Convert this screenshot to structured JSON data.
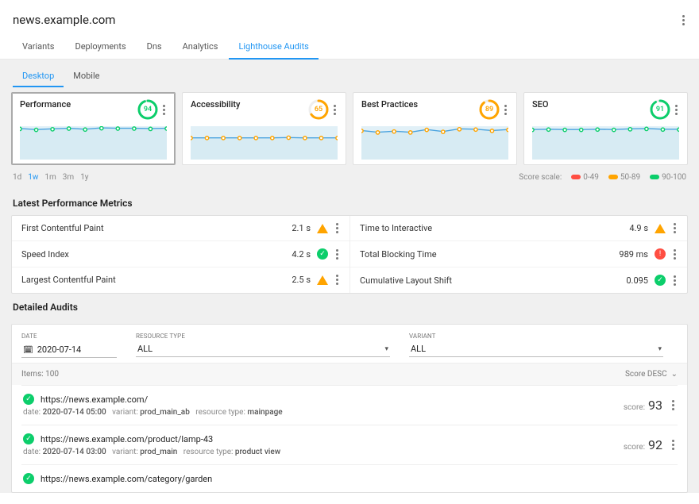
{
  "header": {
    "site_title": "news.example.com",
    "tabs": [
      "Variants",
      "Deployments",
      "Dns",
      "Analytics",
      "Lighthouse Audits"
    ],
    "active_tab_index": 4
  },
  "device_tabs": {
    "items": [
      "Desktop",
      "Mobile"
    ],
    "active_index": 0
  },
  "score_cards": [
    {
      "title": "Performance",
      "score": 94,
      "color": "#0cce6b",
      "selected": true
    },
    {
      "title": "Accessibility",
      "score": 65,
      "color": "#ffa400",
      "selected": false
    },
    {
      "title": "Best Practices",
      "score": 89,
      "color": "#ffa400",
      "selected": false
    },
    {
      "title": "SEO",
      "score": 91,
      "color": "#0cce6b",
      "selected": false
    }
  ],
  "chart_data": [
    {
      "type": "line",
      "title": "Performance",
      "series": [
        {
          "name": "score",
          "values": [
            93,
            90,
            92,
            94,
            91,
            95,
            94,
            94,
            93,
            94
          ]
        }
      ],
      "ylim": [
        0,
        100
      ],
      "point_color": "#0cce6b",
      "line_color": "#4aa3df"
    },
    {
      "type": "line",
      "title": "Accessibility",
      "series": [
        {
          "name": "score",
          "values": [
            65,
            65,
            65,
            65,
            65,
            65,
            66,
            65,
            65,
            65
          ]
        }
      ],
      "ylim": [
        0,
        100
      ],
      "point_color": "#ffa400",
      "line_color": "#4aa3df"
    },
    {
      "type": "line",
      "title": "Best Practices",
      "series": [
        {
          "name": "score",
          "values": [
            87,
            82,
            85,
            82,
            90,
            84,
            92,
            91,
            87,
            90
          ]
        }
      ],
      "ylim": [
        0,
        100
      ],
      "point_color": "#ffa400",
      "line_color": "#4aa3df"
    },
    {
      "type": "line",
      "title": "SEO",
      "series": [
        {
          "name": "score",
          "values": [
            90,
            91,
            90,
            90,
            91,
            90,
            92,
            93,
            91,
            91
          ]
        }
      ],
      "ylim": [
        0,
        100
      ],
      "point_color": "#0cce6b",
      "line_color": "#4aa3df"
    }
  ],
  "time_range": {
    "items": [
      "1d",
      "1w",
      "1m",
      "3m",
      "1y"
    ],
    "active_index": 1
  },
  "score_scale": {
    "label": "Score scale:",
    "ranges": [
      {
        "label": "0-49",
        "color": "#ff4e42"
      },
      {
        "label": "50-89",
        "color": "#ffa400"
      },
      {
        "label": "90-100",
        "color": "#0cce6b"
      }
    ]
  },
  "metrics": {
    "section_title": "Latest Performance Metrics",
    "left": [
      {
        "label": "First Contentful Paint",
        "value": "2.1 s",
        "status": "warn"
      },
      {
        "label": "Speed Index",
        "value": "4.2 s",
        "status": "pass"
      },
      {
        "label": "Largest Contentful Paint",
        "value": "2.5 s",
        "status": "warn"
      }
    ],
    "right": [
      {
        "label": "Time to Interactive",
        "value": "4.9 s",
        "status": "warn"
      },
      {
        "label": "Total Blocking Time",
        "value": "989 ms",
        "status": "fail"
      },
      {
        "label": "Cumulative Layout Shift",
        "value": "0.095",
        "status": "pass"
      }
    ]
  },
  "detailed": {
    "section_title": "Detailed Audits",
    "filters": {
      "date_label": "DATE",
      "date_value": "2020-07-14",
      "resourcetype_label": "RESOURCE TYPE",
      "resourcetype_value": "ALL",
      "variant_label": "VARIANT",
      "variant_value": "ALL"
    },
    "items_count_label": "Items:",
    "items_count": "100",
    "sort_label": "Score DESC",
    "items": [
      {
        "url": "https://news.example.com/",
        "date": "2020-07-14 05:00",
        "variant": "prod_main_ab",
        "resource_type": "mainpage",
        "score_label": "score:",
        "score": "93",
        "status": "pass"
      },
      {
        "url": "https://news.example.com/product/lamp-43",
        "date": "2020-07-14 03:00",
        "variant": "prod_main",
        "resource_type": "product view",
        "score_label": "score:",
        "score": "92",
        "status": "pass"
      },
      {
        "url": "https://news.example.com/category/garden",
        "date": "",
        "variant": "",
        "resource_type": "",
        "score_label": "",
        "score": "",
        "status": "pass"
      }
    ],
    "meta_labels": {
      "date": "date:",
      "variant": "variant:",
      "resource_type": "resource type:"
    }
  }
}
